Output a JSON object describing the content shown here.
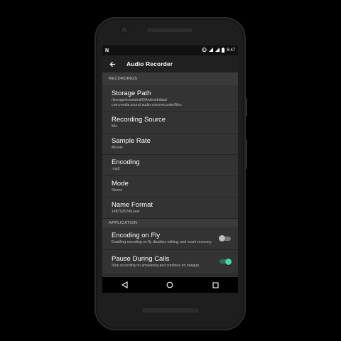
{
  "status_bar": {
    "left_icon": "n-notification-icon",
    "time": "6:47",
    "icons": [
      "vibrate-icon",
      "wifi-icon",
      "signal-icon",
      "battery-icon"
    ]
  },
  "app_bar": {
    "title": "Audio Recorder",
    "back_icon": "arrow-back-icon"
  },
  "sections": {
    "recordings": {
      "label": "RECORDINGS"
    },
    "application": {
      "label": "APPLICATION"
    }
  },
  "settings": {
    "storage_path": {
      "title": "Storage Path",
      "value": "/storage/emulated/0/Android/data/\ncom.media.sound.audio.voicerecorder/files"
    },
    "recording_source": {
      "title": "Recording Source",
      "value": "Mic"
    },
    "sample_rate": {
      "title": "Sample Rate",
      "value": "48 kHz"
    },
    "encoding": {
      "title": "Encoding",
      "value": ".mp3"
    },
    "mode": {
      "title": "Mode",
      "value": "Stereo"
    },
    "name_format": {
      "title": "Name Format",
      "value": "1487925249.wav"
    },
    "encoding_on_fly": {
      "title": "Encoding on Fly",
      "value": "Enabling encoding on fly disables editing, and crash recovery",
      "enabled": false
    },
    "pause_during_calls": {
      "title": "Pause During Calls",
      "value": "Stop recording on answering and continue on hangup",
      "enabled": true
    }
  },
  "colors": {
    "accent": "#4fd1a8",
    "app_bar": "#212121",
    "background": "#2f2f2f"
  },
  "nav_bar": {
    "icons": [
      "back-triangle-icon",
      "home-circle-icon",
      "recents-square-icon"
    ]
  }
}
